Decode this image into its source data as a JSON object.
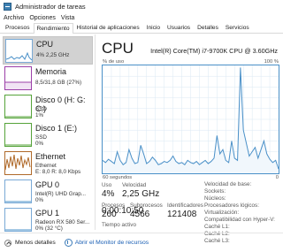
{
  "window": {
    "title": "Administrador de tareas"
  },
  "menu": [
    "Archivo",
    "Opciones",
    "Vista"
  ],
  "tabs": [
    "Procesos",
    "Rendimiento",
    "Historial de aplicaciones",
    "Inicio",
    "Usuarios",
    "Detalles",
    "Servicios"
  ],
  "active_tab": "Rendimiento",
  "sidebar": {
    "items": [
      {
        "name": "CPU",
        "line1": "4%  2,25 GHz",
        "line2": ""
      },
      {
        "name": "Memoria",
        "line1": "8,5/31,8 GB (27%)",
        "line2": ""
      },
      {
        "name": "Disco 0 (H: G: C:)",
        "line1": "SSD",
        "line2": "1%"
      },
      {
        "name": "Disco 1 (E:)",
        "line1": "SSD",
        "line2": "0%"
      },
      {
        "name": "Ethernet",
        "line1": "Ethernet",
        "line2": "E: 8,0  R: 8,0 Kbps"
      },
      {
        "name": "GPU 0",
        "line1": "Intel(R) UHD Grap...",
        "line2": "0%"
      },
      {
        "name": "GPU 1",
        "line1": "Radeon RX 580 Ser...",
        "line2": "0%  (32 °C)"
      }
    ]
  },
  "main": {
    "title": "CPU",
    "model": "Intel(R) Core(TM) i7-9700K CPU @ 3.60GHz",
    "axis_top_left": "% de uso",
    "axis_top_right": "100 %",
    "axis_bottom_left": "60 segundos",
    "axis_bottom_right": "0",
    "stats": {
      "uso_label": "Uso",
      "uso_value": "4%",
      "velocidad_label": "Velocidad",
      "velocidad_value": "2,25 GHz",
      "procesos_label": "Procesos",
      "procesos_value": "260",
      "subprocesos_label": "Subprocesos",
      "subprocesos_value": "4566",
      "identificadores_label": "Identificadores",
      "identificadores_value": "121408",
      "tiempo_label": "Tiempo activo",
      "tiempo_value": "0:00:10:50"
    },
    "specs": [
      "Velocidad de base:",
      "Sockets:",
      "Núcleos:",
      "Procesadores lógicos:",
      "Virtualización:",
      "Compatibilidad con Hyper-V:",
      "Caché L1:",
      "Caché L2:",
      "Caché L3:"
    ]
  },
  "footer": {
    "less_details": "Menos detalles",
    "open_monitor": "Abrir el Monitor de recursos"
  },
  "chart_data": {
    "type": "area",
    "xlabel": "60 segundos",
    "ylabel": "% de uso",
    "ylim": [
      0,
      100
    ],
    "x": [
      0,
      1,
      2,
      3,
      4,
      5,
      6,
      7,
      8,
      9,
      10,
      11,
      12,
      13,
      14,
      15,
      16,
      17,
      18,
      19,
      20,
      21,
      22,
      23,
      24,
      25,
      26,
      27,
      28,
      29,
      30,
      31,
      32,
      33,
      34,
      35,
      36,
      37,
      38,
      39,
      40,
      41,
      42,
      43,
      44,
      45,
      46,
      47,
      48,
      49,
      50,
      51,
      52,
      53,
      54,
      55,
      56,
      57,
      58,
      59,
      60
    ],
    "values": [
      12,
      10,
      13,
      11,
      9,
      20,
      12,
      8,
      10,
      22,
      14,
      9,
      10,
      26,
      18,
      9,
      11,
      15,
      12,
      8,
      9,
      11,
      10,
      12,
      16,
      11,
      9,
      10,
      8,
      12,
      10,
      9,
      11,
      8,
      10,
      12,
      9,
      11,
      14,
      35,
      18,
      22,
      12,
      10,
      30,
      14,
      12,
      98,
      40,
      28,
      16,
      20,
      24,
      14,
      22,
      30,
      18,
      13,
      10,
      12,
      4
    ],
    "colors": {
      "line": "#4a90c8",
      "fill": "#f1f7fc",
      "grid": "#dbe8f3"
    }
  },
  "colors": {
    "accent": "#4a90c8",
    "memory": "#9c3fa8",
    "disk": "#56a33a",
    "ethernet": "#b06a2a",
    "gpu": "#4a90c8"
  }
}
